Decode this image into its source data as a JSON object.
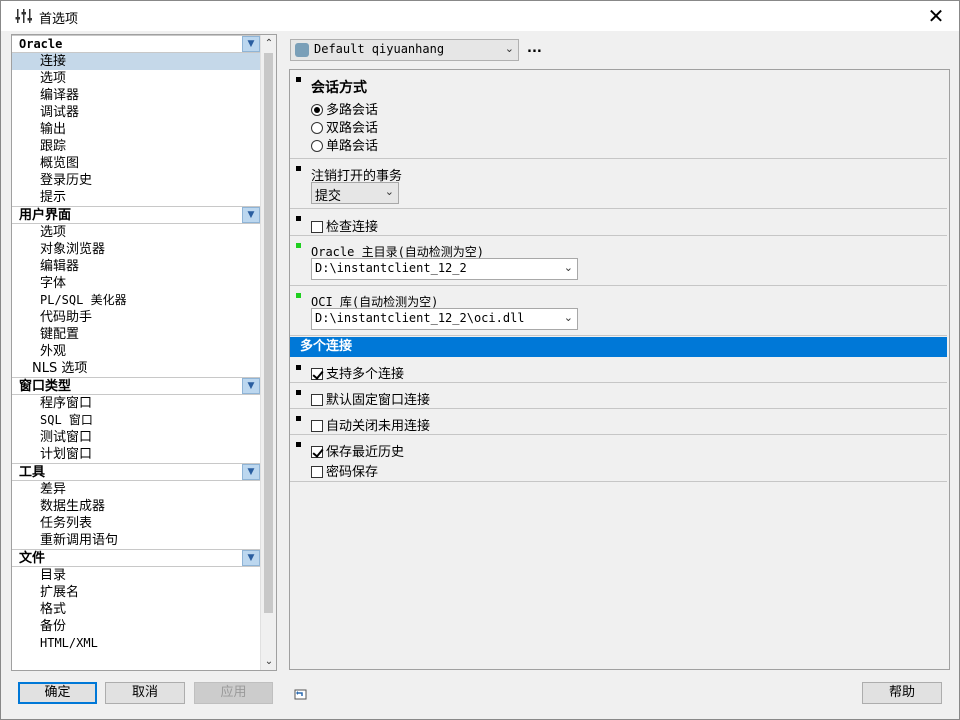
{
  "window": {
    "title": "首选项",
    "close_glyph": "✕"
  },
  "tree": {
    "sections": [
      {
        "title": "Oracle",
        "items": [
          "连接",
          "选项",
          "编译器",
          "调试器",
          "输出",
          "跟踪",
          "概览图",
          "登录历史",
          "提示"
        ],
        "selected_index": 0
      },
      {
        "title": "用户界面",
        "items": [
          "选项",
          "对象浏览器",
          "编辑器",
          "字体",
          "PL/SQL 美化器",
          "代码助手",
          "键配置",
          "外观",
          "NLS 选项"
        ]
      },
      {
        "title": "窗口类型",
        "items": [
          "程序窗口",
          "SQL 窗口",
          "测试窗口",
          "计划窗口"
        ]
      },
      {
        "title": "工具",
        "items": [
          "差异",
          "数据生成器",
          "任务列表",
          "重新调用语句"
        ]
      },
      {
        "title": "文件",
        "items": [
          "目录",
          "扩展名",
          "格式",
          "备份",
          "HTML/XML"
        ]
      }
    ]
  },
  "profile": {
    "value": "Default qiyuanhang",
    "more_label": "..."
  },
  "session": {
    "title": "会话方式",
    "options": [
      "多路会话",
      "双路会话",
      "单路会话"
    ],
    "selected_index": 0
  },
  "logoff": {
    "label": "注销打开的事务",
    "value": "提交"
  },
  "check_connection": {
    "label": "检查连接",
    "checked": false
  },
  "oracle_home": {
    "label": "Oracle 主目录(自动检测为空)",
    "value": "D:\\instantclient_12_2"
  },
  "oci_lib": {
    "label": "OCI 库(自动检测为空)",
    "value": "D:\\instantclient_12_2\\oci.dll"
  },
  "multi": {
    "header": "多个连接",
    "support": {
      "label": "支持多个连接",
      "checked": true
    },
    "fixed": {
      "label": "默认固定窗口连接",
      "checked": false
    },
    "autoclose": {
      "label": "自动关闭未用连接",
      "checked": false
    },
    "history": {
      "label": "保存最近历史",
      "checked": true
    },
    "password": {
      "label": "密码保存",
      "checked": false
    }
  },
  "buttons": {
    "ok": "确定",
    "cancel": "取消",
    "apply": "应用",
    "help": "帮助"
  },
  "colors": {
    "accent": "#0078d7",
    "selection": "#c5d8e9",
    "marker_green": "#1fd01f"
  }
}
